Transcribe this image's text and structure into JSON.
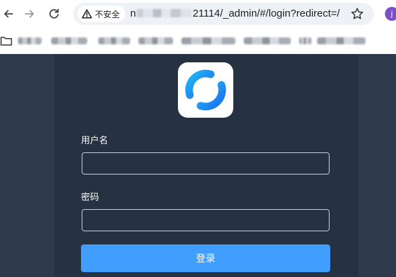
{
  "browser": {
    "security_chip": {
      "icon": "warning-triangle-icon",
      "label": "不安全"
    },
    "url": {
      "prefix": "n",
      "suffix": "21114/_admin/#/login?redirect=/"
    },
    "profile_initial": "j",
    "icons": {
      "back": "arrow-left-icon",
      "forward": "arrow-right-icon",
      "reload": "reload-icon",
      "bookmark": "star-icon",
      "folder": "folder-icon"
    }
  },
  "login": {
    "logo_icon": "ring-logo-icon",
    "username_label": "用户名",
    "username_value": "",
    "password_label": "密码",
    "password_value": "",
    "submit_label": "登录"
  },
  "colors": {
    "page_bg": "#2e3a4c",
    "panel_bg": "#263241",
    "accent": "#409eff",
    "logo_gradient": [
      "#22b8f0",
      "#1a6ef2"
    ]
  }
}
